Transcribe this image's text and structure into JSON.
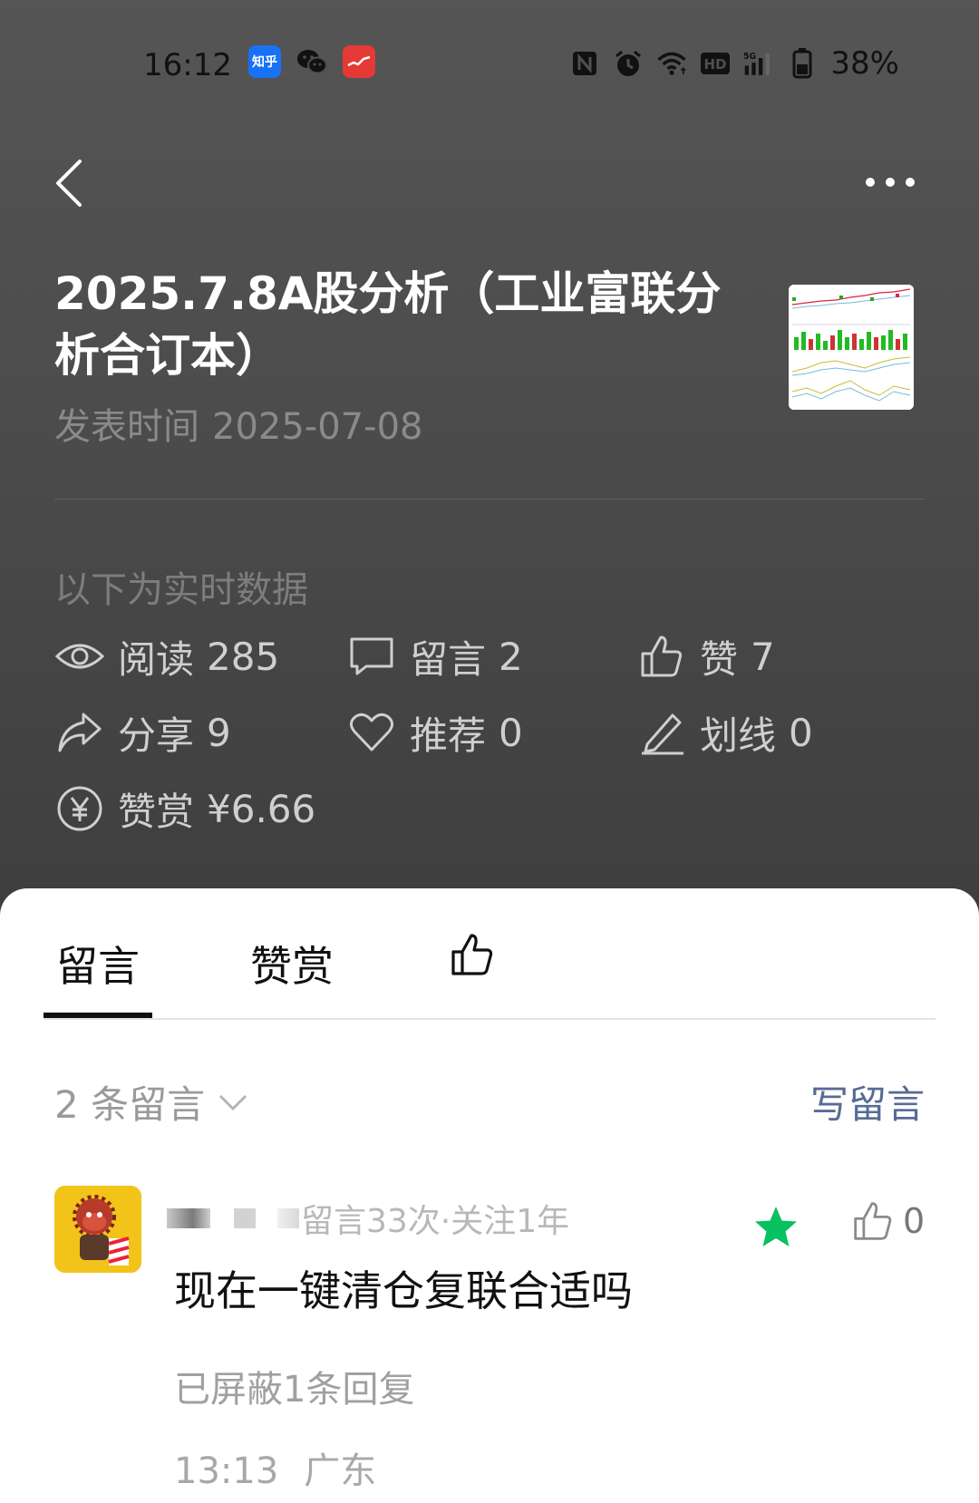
{
  "status_bar": {
    "time": "16:12",
    "zhihu_label": "知乎",
    "battery": "38%"
  },
  "article": {
    "title": "2025.7.8A股分析（工业富联分析合订本）",
    "publish_label": "发表时间",
    "publish_date": "2025-07-08"
  },
  "stats": {
    "realtime_label": "以下为实时数据",
    "read_label": "阅读",
    "read_value": "285",
    "comment_label": "留言",
    "comment_value": "2",
    "like_label": "赞",
    "like_value": "7",
    "share_label": "分享",
    "share_value": "9",
    "recommend_label": "推荐",
    "recommend_value": "0",
    "underline_label": "划线",
    "underline_value": "0",
    "reward_label": "赞赏",
    "reward_value": "¥6.66"
  },
  "tabs": {
    "comments": "留言",
    "reward": "赞赏"
  },
  "comments_section": {
    "count_text": "2 条留言",
    "write_label": "写留言"
  },
  "comment": {
    "meta": "留言33次·关注1年",
    "text": "现在一键清仓复联合适吗",
    "hidden_replies": "已屏蔽1条回复",
    "time": "13:13",
    "location": "广东",
    "likes": "0"
  },
  "colors": {
    "star": "#07c160",
    "link": "#576b95"
  }
}
